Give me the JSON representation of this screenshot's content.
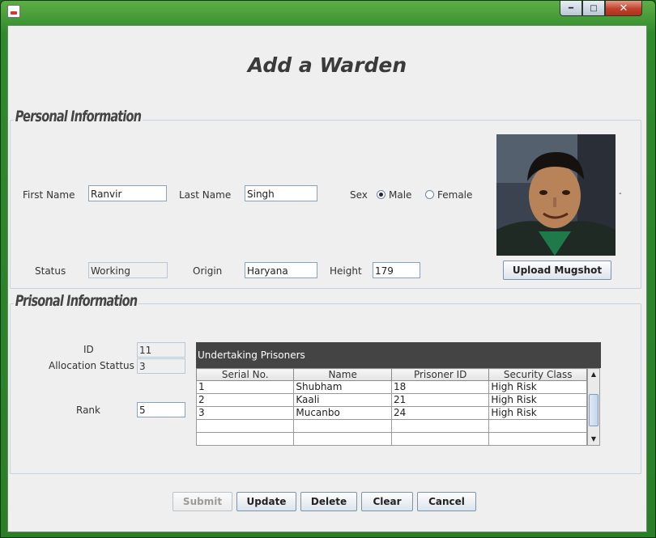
{
  "window": {
    "minimize_icon": "minimize-icon",
    "maximize_icon": "maximize-icon",
    "close_icon": "close-icon"
  },
  "page_title": "Add a Warden",
  "personal": {
    "legend": "Personal Information",
    "first_name_label": "First Name",
    "first_name_value": "Ranvir",
    "last_name_label": "Last Name",
    "last_name_value": "Singh",
    "sex_label": "Sex",
    "male_label": "Male",
    "female_label": "Female",
    "selected_sex": "Male",
    "status_label": "Status",
    "status_value": "Working",
    "origin_label": "Origin",
    "origin_value": "Haryana",
    "height_label": "Height",
    "height_value": "179",
    "upload_button": "Upload Mugshot"
  },
  "prisonal": {
    "legend": "Prisonal Information",
    "id_label": "ID",
    "id_value": "11",
    "allocation_label": "Allocation Stattus",
    "allocation_value": "3",
    "rank_label": "Rank",
    "rank_value": "5"
  },
  "prisoners_table": {
    "title": "Undertaking Prisoners",
    "columns": [
      "Serial No.",
      "Name",
      "Prisoner ID",
      "Security Class"
    ],
    "rows": [
      [
        "1",
        "Shubham",
        "18",
        "High Risk"
      ],
      [
        "2",
        "Kaali",
        "21",
        "High Risk"
      ],
      [
        "3",
        "Mucanbo",
        "24",
        "High Risk"
      ],
      [
        "",
        "",
        "",
        ""
      ],
      [
        "",
        "",
        "",
        ""
      ]
    ]
  },
  "actions": {
    "submit": "Submit",
    "update": "Update",
    "delete": "Delete",
    "clear": "Clear",
    "cancel": "Cancel"
  }
}
